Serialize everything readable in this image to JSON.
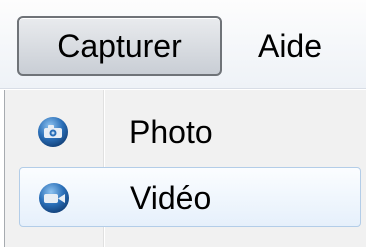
{
  "menubar": {
    "items": [
      {
        "label": "Capturer"
      },
      {
        "label": "Aide"
      }
    ]
  },
  "dropdown": {
    "items": [
      {
        "label": "Photo",
        "icon": "camera-icon"
      },
      {
        "label": "Vidéo",
        "icon": "video-camera-icon"
      }
    ]
  },
  "colors": {
    "icon_blue": "#2a6fb8",
    "highlight_border": "#b3cde8"
  }
}
